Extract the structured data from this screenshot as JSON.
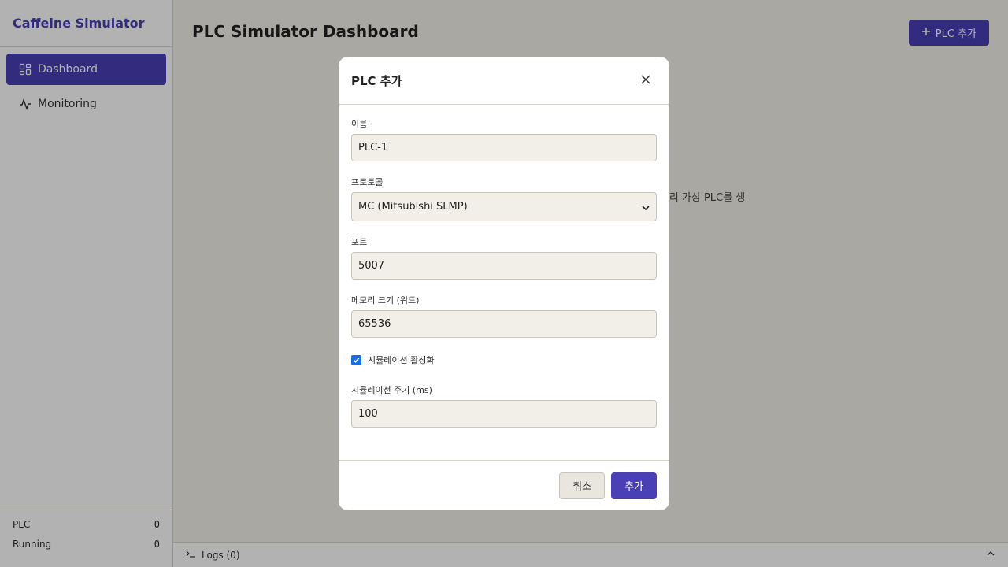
{
  "app": {
    "title": "Caffeine Simulator"
  },
  "nav": [
    {
      "label": "Dashboard",
      "icon": "dashboard-icon",
      "active": true
    },
    {
      "label": "Monitoring",
      "icon": "activity-icon",
      "active": false
    }
  ],
  "stats": [
    {
      "label": "PLC",
      "value": "0"
    },
    {
      "label": "Running",
      "value": "0"
    }
  ],
  "main": {
    "title": "PLC Simulator Dashboard",
    "add_button": "PLC 추가",
    "empty_message": "리 가상 PLC를 생"
  },
  "logs": {
    "label": "Logs (0)"
  },
  "modal": {
    "title": "PLC 추가",
    "fields": {
      "name": {
        "label": "이름",
        "value": "PLC-1"
      },
      "protocol": {
        "label": "프로토콜",
        "value": "MC (Mitsubishi SLMP)"
      },
      "port": {
        "label": "포트",
        "value": "5007"
      },
      "memory": {
        "label": "메모리 크기 (워드)",
        "value": "65536"
      },
      "simulation_enabled": {
        "label": "시뮬레이션 활성화",
        "checked": true
      },
      "interval": {
        "label": "시뮬레이션 주기 (ms)",
        "value": "100"
      }
    },
    "cancel_label": "취소",
    "submit_label": "추가"
  },
  "colors": {
    "accent": "#4a3fb5",
    "background": "#f4f1ea",
    "checkbox": "#1a6fe0"
  }
}
